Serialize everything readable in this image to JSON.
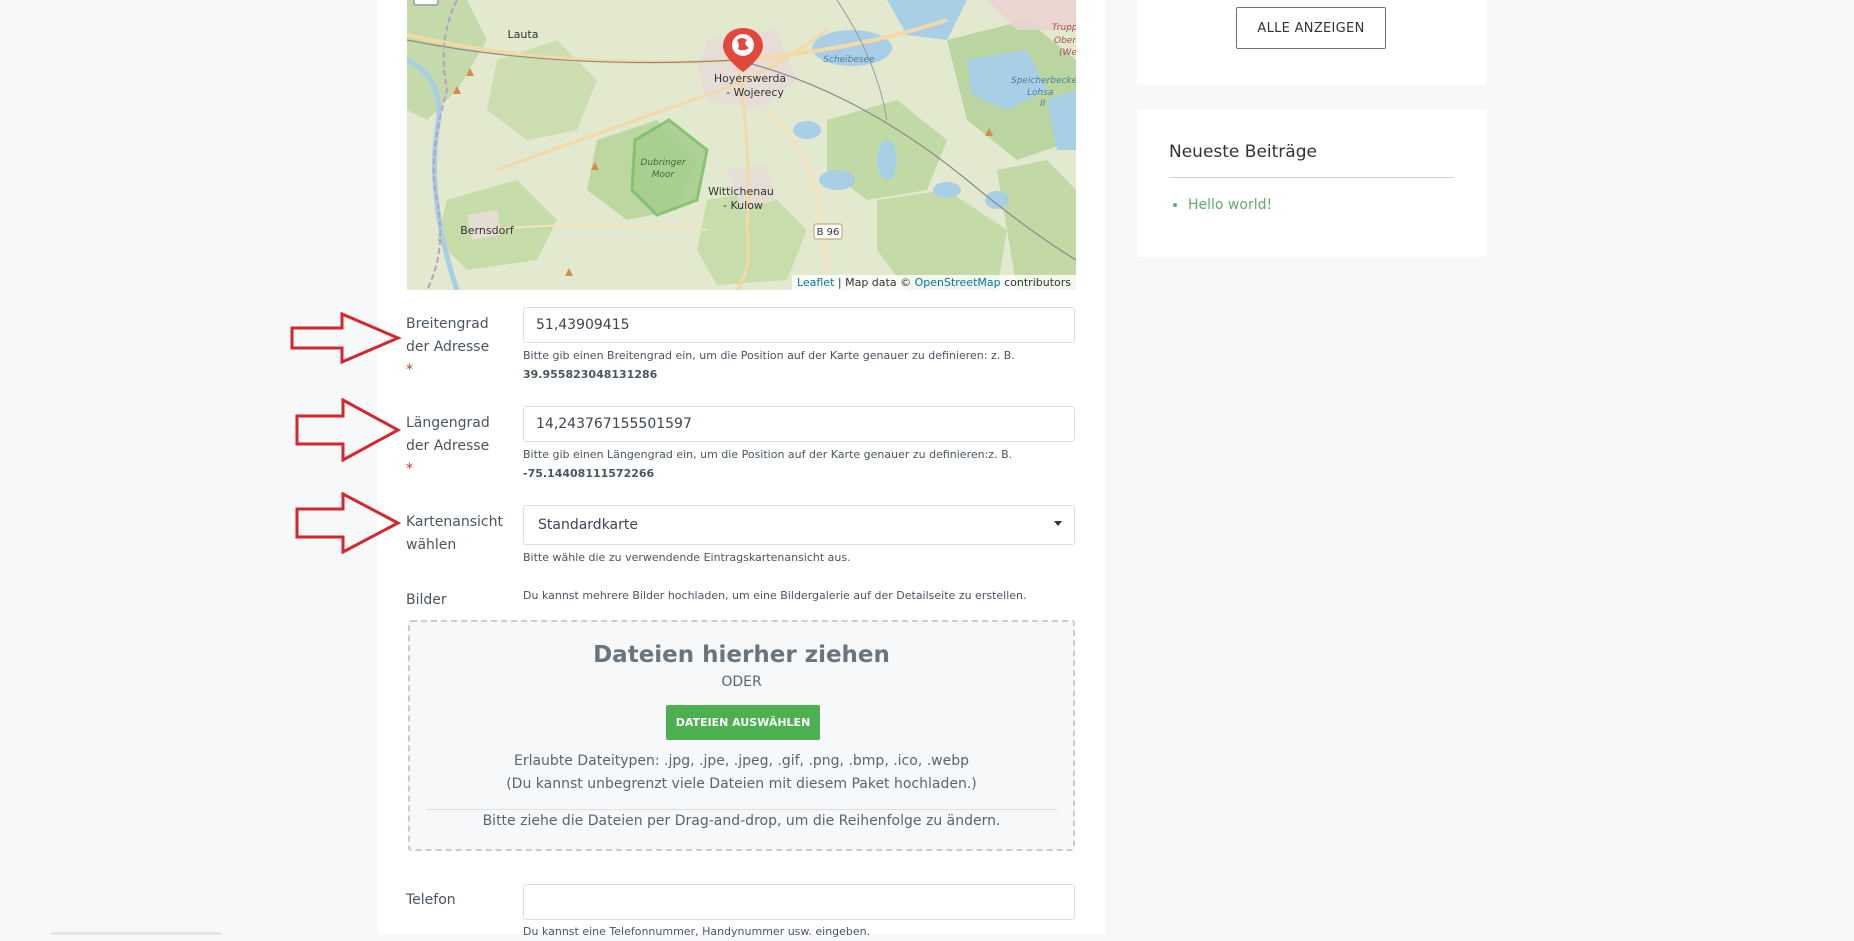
{
  "sidebar": {
    "show_all_label": "ALLE ANZEIGEN",
    "recent_posts_title": "Neueste Beiträge",
    "recent_posts": [
      "Hello world!"
    ]
  },
  "map": {
    "places": [
      "Lauta",
      "Hoyerswerda",
      "- Wojerecy",
      "Scheibesee",
      "Truppenü",
      "Ober",
      "(Wes",
      "Speicherbecken",
      "Lohsa",
      "II",
      "Dubringer",
      "Moor",
      "Wittichenau",
      "- Kulow",
      "B 96",
      "Bernsdorf"
    ],
    "attribution": {
      "leaflet": "Leaflet",
      "separator": " | Map data © ",
      "osm": "OpenStreetMap",
      "suffix": " contributors"
    }
  },
  "form": {
    "latitude": {
      "label": "Breitengrad der Adresse",
      "required_mark": "*",
      "value": "51,43909415",
      "help": "Bitte gib einen Breitengrad ein, um die Position auf der Karte genauer zu definieren: z. B.",
      "example": "39.955823048131286"
    },
    "longitude": {
      "label": "Längengrad der Adresse",
      "required_mark": "*",
      "value": "14,243767155501597",
      "help": "Bitte gib einen Längengrad ein, um die Position auf der Karte genauer zu definieren:z. B.",
      "example": "-75.14408111572266"
    },
    "map_view": {
      "label": "Kartenansicht wählen",
      "selected": "Standardkarte",
      "help": "Bitte wähle die zu verwendende Eintragskartenansicht aus."
    },
    "images": {
      "label": "Bilder",
      "help": "Du kannst mehrere Bilder hochladen, um eine Bildergalerie auf der Detailseite zu erstellen.",
      "drop_title": "Dateien hierher ziehen",
      "or": "ODER",
      "select_button": "DATEIEN AUSWÄHLEN",
      "allowed_types": "Erlaubte Dateitypen: .jpg, .jpe, .jpeg, .gif, .png, .bmp, .ico, .webp",
      "limit": "(Du kannst unbegrenzt viele Dateien mit diesem Paket hochladen.)",
      "reorder": "Bitte ziehe die Dateien per Drag-and-drop, um die Reihenfolge zu ändern."
    },
    "phone": {
      "label": "Telefon",
      "value": "",
      "help": "Du kannst eine Telefonnummer, Handynummer usw. eingeben."
    }
  },
  "colors": {
    "annotation_arrow": "#d6262b",
    "accent_green": "#4caf50",
    "link_green": "#5eab6d",
    "required_red": "#d0312d"
  }
}
